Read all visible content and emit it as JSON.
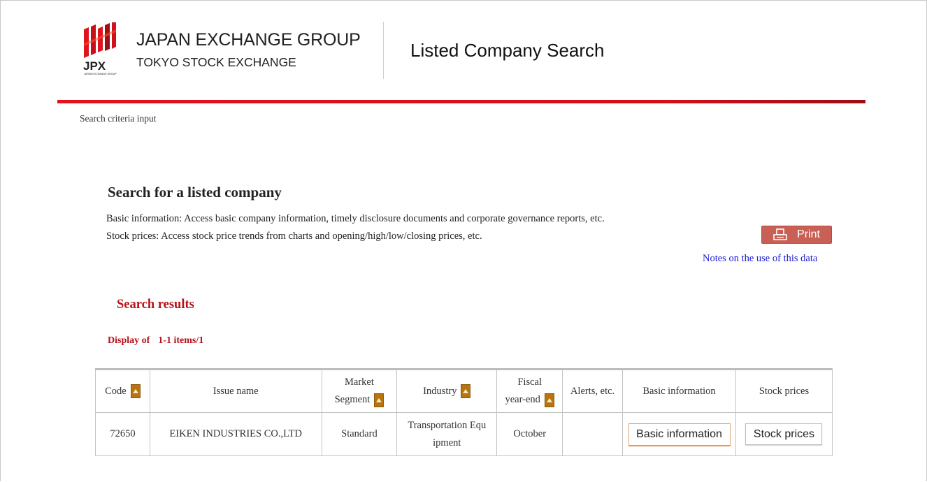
{
  "header": {
    "logo_text": "JPX",
    "logo_subtext": "JAPAN EXCHANGE GROUP",
    "group_name": "JAPAN EXCHANGE GROUP",
    "exchange_name": "TOKYO STOCK EXCHANGE",
    "page_title": "Listed Company Search",
    "accent_color": "#e1121c"
  },
  "breadcrumb": "Search criteria input",
  "intro": {
    "title": "Search for a listed company",
    "line1": "Basic information: Access basic company information, timely disclosure documents and corporate governance reports, etc.",
    "line2": "Stock prices: Access stock price trends from charts and opening/high/low/closing prices, etc.",
    "print_label": "Print",
    "print_icon": "printer-icon",
    "notes_link": "Notes on the use of this data"
  },
  "results": {
    "title": "Search results",
    "display_label": "Display of",
    "display_range": "1-1 items/1",
    "columns": {
      "code": "Code",
      "issue_name": "Issue name",
      "market_segment_1": "Market",
      "market_segment_2": "Segment",
      "industry": "Industry",
      "fiscal_1": "Fiscal",
      "fiscal_2": "year-end",
      "alerts": "Alerts, etc.",
      "basic_info": "Basic information",
      "stock_prices": "Stock prices"
    },
    "rows": [
      {
        "code": "72650",
        "issue_name": "EIKEN INDUSTRIES CO.,LTD",
        "market_segment": "Standard",
        "industry_1": "Transportation Equ",
        "industry_2": "ipment",
        "fiscal_year_end": "October",
        "alerts": "",
        "basic_info_button": "Basic information",
        "stock_prices_button": "Stock prices"
      }
    ]
  }
}
